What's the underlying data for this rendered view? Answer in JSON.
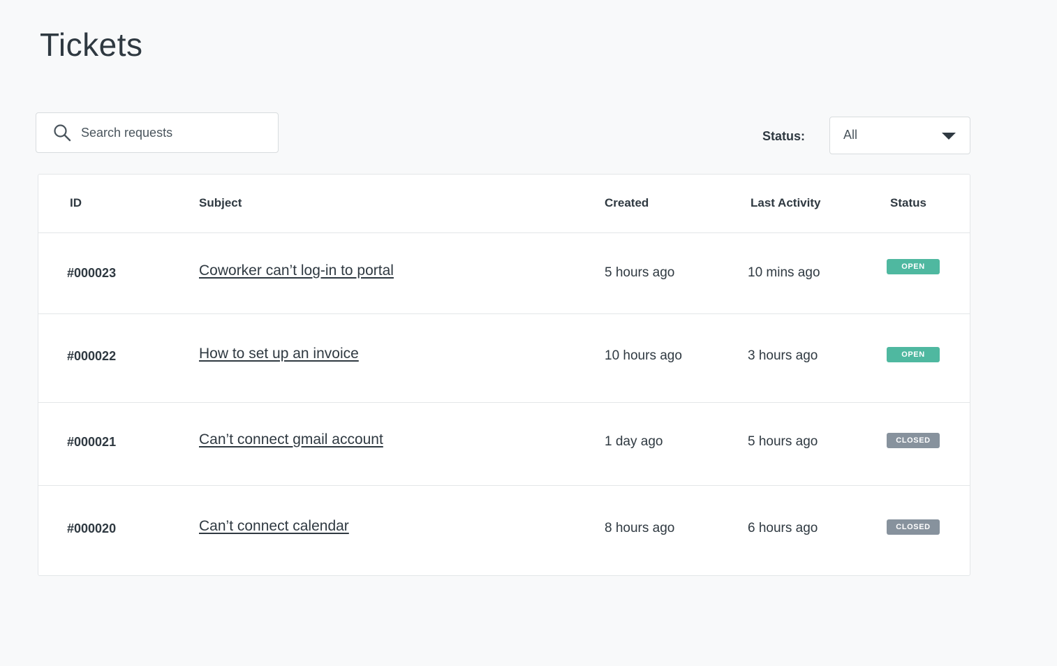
{
  "page": {
    "title": "Tickets"
  },
  "search": {
    "icon": "search-icon",
    "placeholder": "Search requests",
    "value": ""
  },
  "filter": {
    "label": "Status:",
    "selected": "All",
    "icon": "chevron-down-icon"
  },
  "table": {
    "columns": {
      "id": "ID",
      "subject": "Subject",
      "created": "Created",
      "last_activity": "Last Activity",
      "status": "Status"
    },
    "rows": [
      {
        "id": "#000023",
        "subject": "Coworker can’t log-in to portal",
        "created": "5 hours ago",
        "last_activity": "10 mins ago",
        "status": "OPEN"
      },
      {
        "id": "#000022",
        "subject": "How to set up an invoice",
        "created": "10 hours ago",
        "last_activity": "3 hours ago",
        "status": "OPEN"
      },
      {
        "id": "#000021",
        "subject": "Can’t connect gmail account",
        "created": "1 day ago",
        "last_activity": "5 hours ago",
        "status": "CLOSED"
      },
      {
        "id": "#000020",
        "subject": "Can’t connect calendar",
        "created": "8 hours ago",
        "last_activity": "6 hours ago",
        "status": "CLOSED"
      }
    ]
  },
  "colors": {
    "open_badge": "#4fb8a0",
    "closed_badge": "#87929d",
    "text": "#2f3941",
    "background": "#f8f9fa"
  }
}
